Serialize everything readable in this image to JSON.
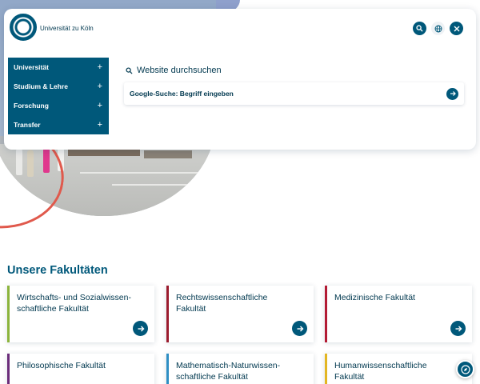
{
  "header": {
    "university_name": "Universität zu Köln"
  },
  "nav": {
    "items": [
      {
        "label": "Universität",
        "expand": "+"
      },
      {
        "label": "Studium & Lehre",
        "expand": "+"
      },
      {
        "label": "Forschung",
        "expand": "+"
      },
      {
        "label": "Transfer",
        "expand": "+"
      }
    ]
  },
  "search": {
    "title": "Website durchsuchen",
    "placeholder": "Google-Suche: Begriff eingeben"
  },
  "faculties": {
    "title": "Unsere Fakultäten",
    "items": [
      {
        "line1": "Wirtschafts- und Sozialwissen-",
        "line2": "schaftliche Fakultät",
        "color": "#8cb43c"
      },
      {
        "line1": "Rechtswissenschaftliche",
        "line2": "Fakultät",
        "color": "#9b1c2e"
      },
      {
        "line1": "Medizinische Fakultät",
        "line2": "",
        "color": "#b31b34"
      },
      {
        "line1": "Philosophische Fakultät",
        "line2": "",
        "color": "#6b2d7a"
      },
      {
        "line1": "Mathematisch-Naturwissen-",
        "line2": "schaftliche Fakultät",
        "color": "#2f8fc4"
      },
      {
        "line1": "Humanwissenschaftliche",
        "line2": "Fakultät",
        "color": "#e3b622"
      }
    ]
  },
  "colors": {
    "primary": "#00587a",
    "accent_coral": "#e0594c"
  },
  "icons": {
    "search": "search-icon",
    "language": "globe-icon",
    "close": "close-icon",
    "arrow": "arrow-right-icon",
    "compass": "compass-icon"
  }
}
